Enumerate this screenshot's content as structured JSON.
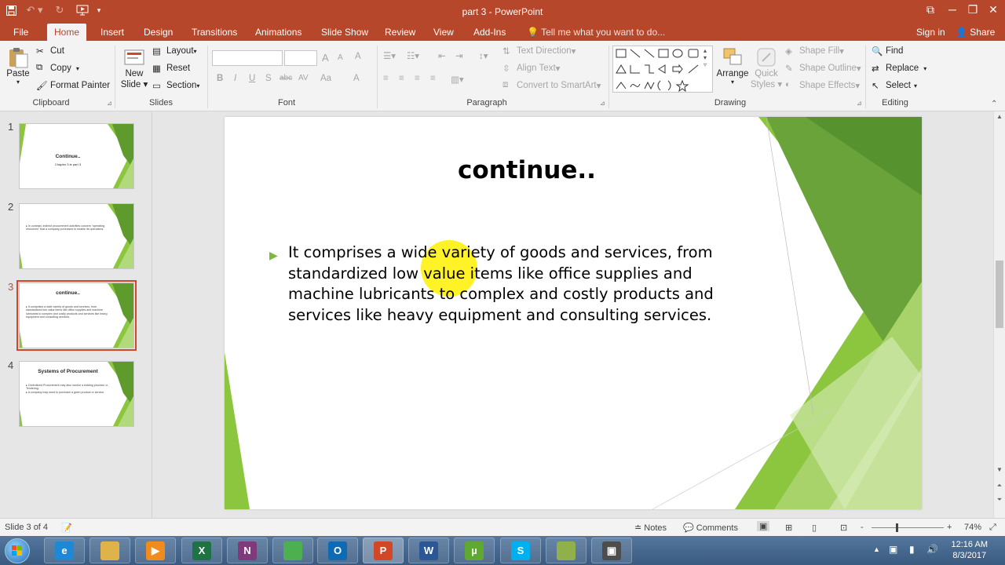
{
  "window": {
    "title": "part 3 - PowerPoint"
  },
  "window_controls": {
    "restore": "⧉",
    "minimize": "─",
    "maximize": "❐",
    "close": "✕"
  },
  "tabs": [
    "File",
    "Home",
    "Insert",
    "Design",
    "Transitions",
    "Animations",
    "Slide Show",
    "Review",
    "View",
    "Add-Ins"
  ],
  "tell_me": "Tell me what you want to do...",
  "account": {
    "signin": "Sign in",
    "share": "Share"
  },
  "ribbon": {
    "clipboard": {
      "label": "Clipboard",
      "paste": "Paste",
      "cut": "Cut",
      "copy": "Copy",
      "format_painter": "Format Painter"
    },
    "slides": {
      "label": "Slides",
      "new_slide_1": "New",
      "new_slide_2": "Slide",
      "layout": "Layout",
      "reset": "Reset",
      "section": "Section"
    },
    "font": {
      "label": "Font",
      "bold": "B",
      "italic": "I",
      "underline": "U",
      "shadow": "S",
      "strike": "abc",
      "spacing": "AV",
      "case": "Aa",
      "grow": "A",
      "shrink": "A",
      "color": "A",
      "clear": "A"
    },
    "paragraph": {
      "label": "Paragraph",
      "text_direction": "Text Direction",
      "align_text": "Align Text",
      "smartart": "Convert to SmartArt"
    },
    "drawing": {
      "label": "Drawing",
      "arrange": "Arrange",
      "quick_styles_1": "Quick",
      "quick_styles_2": "Styles",
      "shape_fill": "Shape Fill",
      "shape_outline": "Shape Outline",
      "shape_effects": "Shape Effects"
    },
    "editing": {
      "label": "Editing",
      "find": "Find",
      "replace": "Replace",
      "select": "Select"
    }
  },
  "thumbnails": [
    {
      "num": "1",
      "title": "Continue..",
      "sub": "Chapter 3 ie part 3"
    },
    {
      "num": "2",
      "title": "",
      "body": "▸ In contrast, indirect procurement activities concern “operating resources” that a company purchases to enable its operations."
    },
    {
      "num": "3",
      "title": "continue..",
      "body": "▸ It comprises a wide variety of goods and services, from standardized low value items like office supplies and machine lubricants to complex and costly products and services like heavy equipment and consulting services."
    },
    {
      "num": "4",
      "title": "Systems of Procurement",
      "body": "▸ Centralized Procurement may also involve a bidding process i.e., Tendering.\n▸ A company may need to purchase a given product or service."
    }
  ],
  "slide": {
    "title": "continue..",
    "body": "It comprises a wide variety of goods and services, from standardized low value items like office supplies and machine lubricants to complex and costly products and services like heavy equipment and consulting services."
  },
  "status": {
    "slide_info": "Slide 3 of 4",
    "notes": "Notes",
    "comments": "Comments",
    "zoom": "74%",
    "zoom_minus": "-",
    "zoom_plus": "+"
  },
  "taskbar": {
    "apps": [
      {
        "name": "Internet Explorer",
        "glyph": "e",
        "color": "#1e88d6"
      },
      {
        "name": "File Explorer",
        "glyph": "",
        "color": "#e0b34a"
      },
      {
        "name": "Media Player",
        "glyph": "▶",
        "color": "#f08c1e"
      },
      {
        "name": "Excel",
        "glyph": "X",
        "color": "#1f7244"
      },
      {
        "name": "OneNote",
        "glyph": "N",
        "color": "#80397b"
      },
      {
        "name": "Chrome",
        "glyph": "",
        "color": "#4caf50"
      },
      {
        "name": "Outlook",
        "glyph": "O",
        "color": "#0f6ab4"
      },
      {
        "name": "PowerPoint",
        "glyph": "P",
        "color": "#d24726"
      },
      {
        "name": "Word",
        "glyph": "W",
        "color": "#2b5797"
      },
      {
        "name": "uTorrent",
        "glyph": "µ",
        "color": "#5fa831"
      },
      {
        "name": "Skype",
        "glyph": "S",
        "color": "#00aff0"
      },
      {
        "name": "Banknote",
        "glyph": "",
        "color": "#8fb04a"
      },
      {
        "name": "Camtasia",
        "glyph": "▣",
        "color": "#4d4d4d"
      }
    ],
    "time": "12:16 AM",
    "date": "8/3/2017"
  },
  "colors": {
    "accent": "#b7472a",
    "selection": "#d24726",
    "bullet": "#7cb83c",
    "highlight": "#ffee00"
  }
}
